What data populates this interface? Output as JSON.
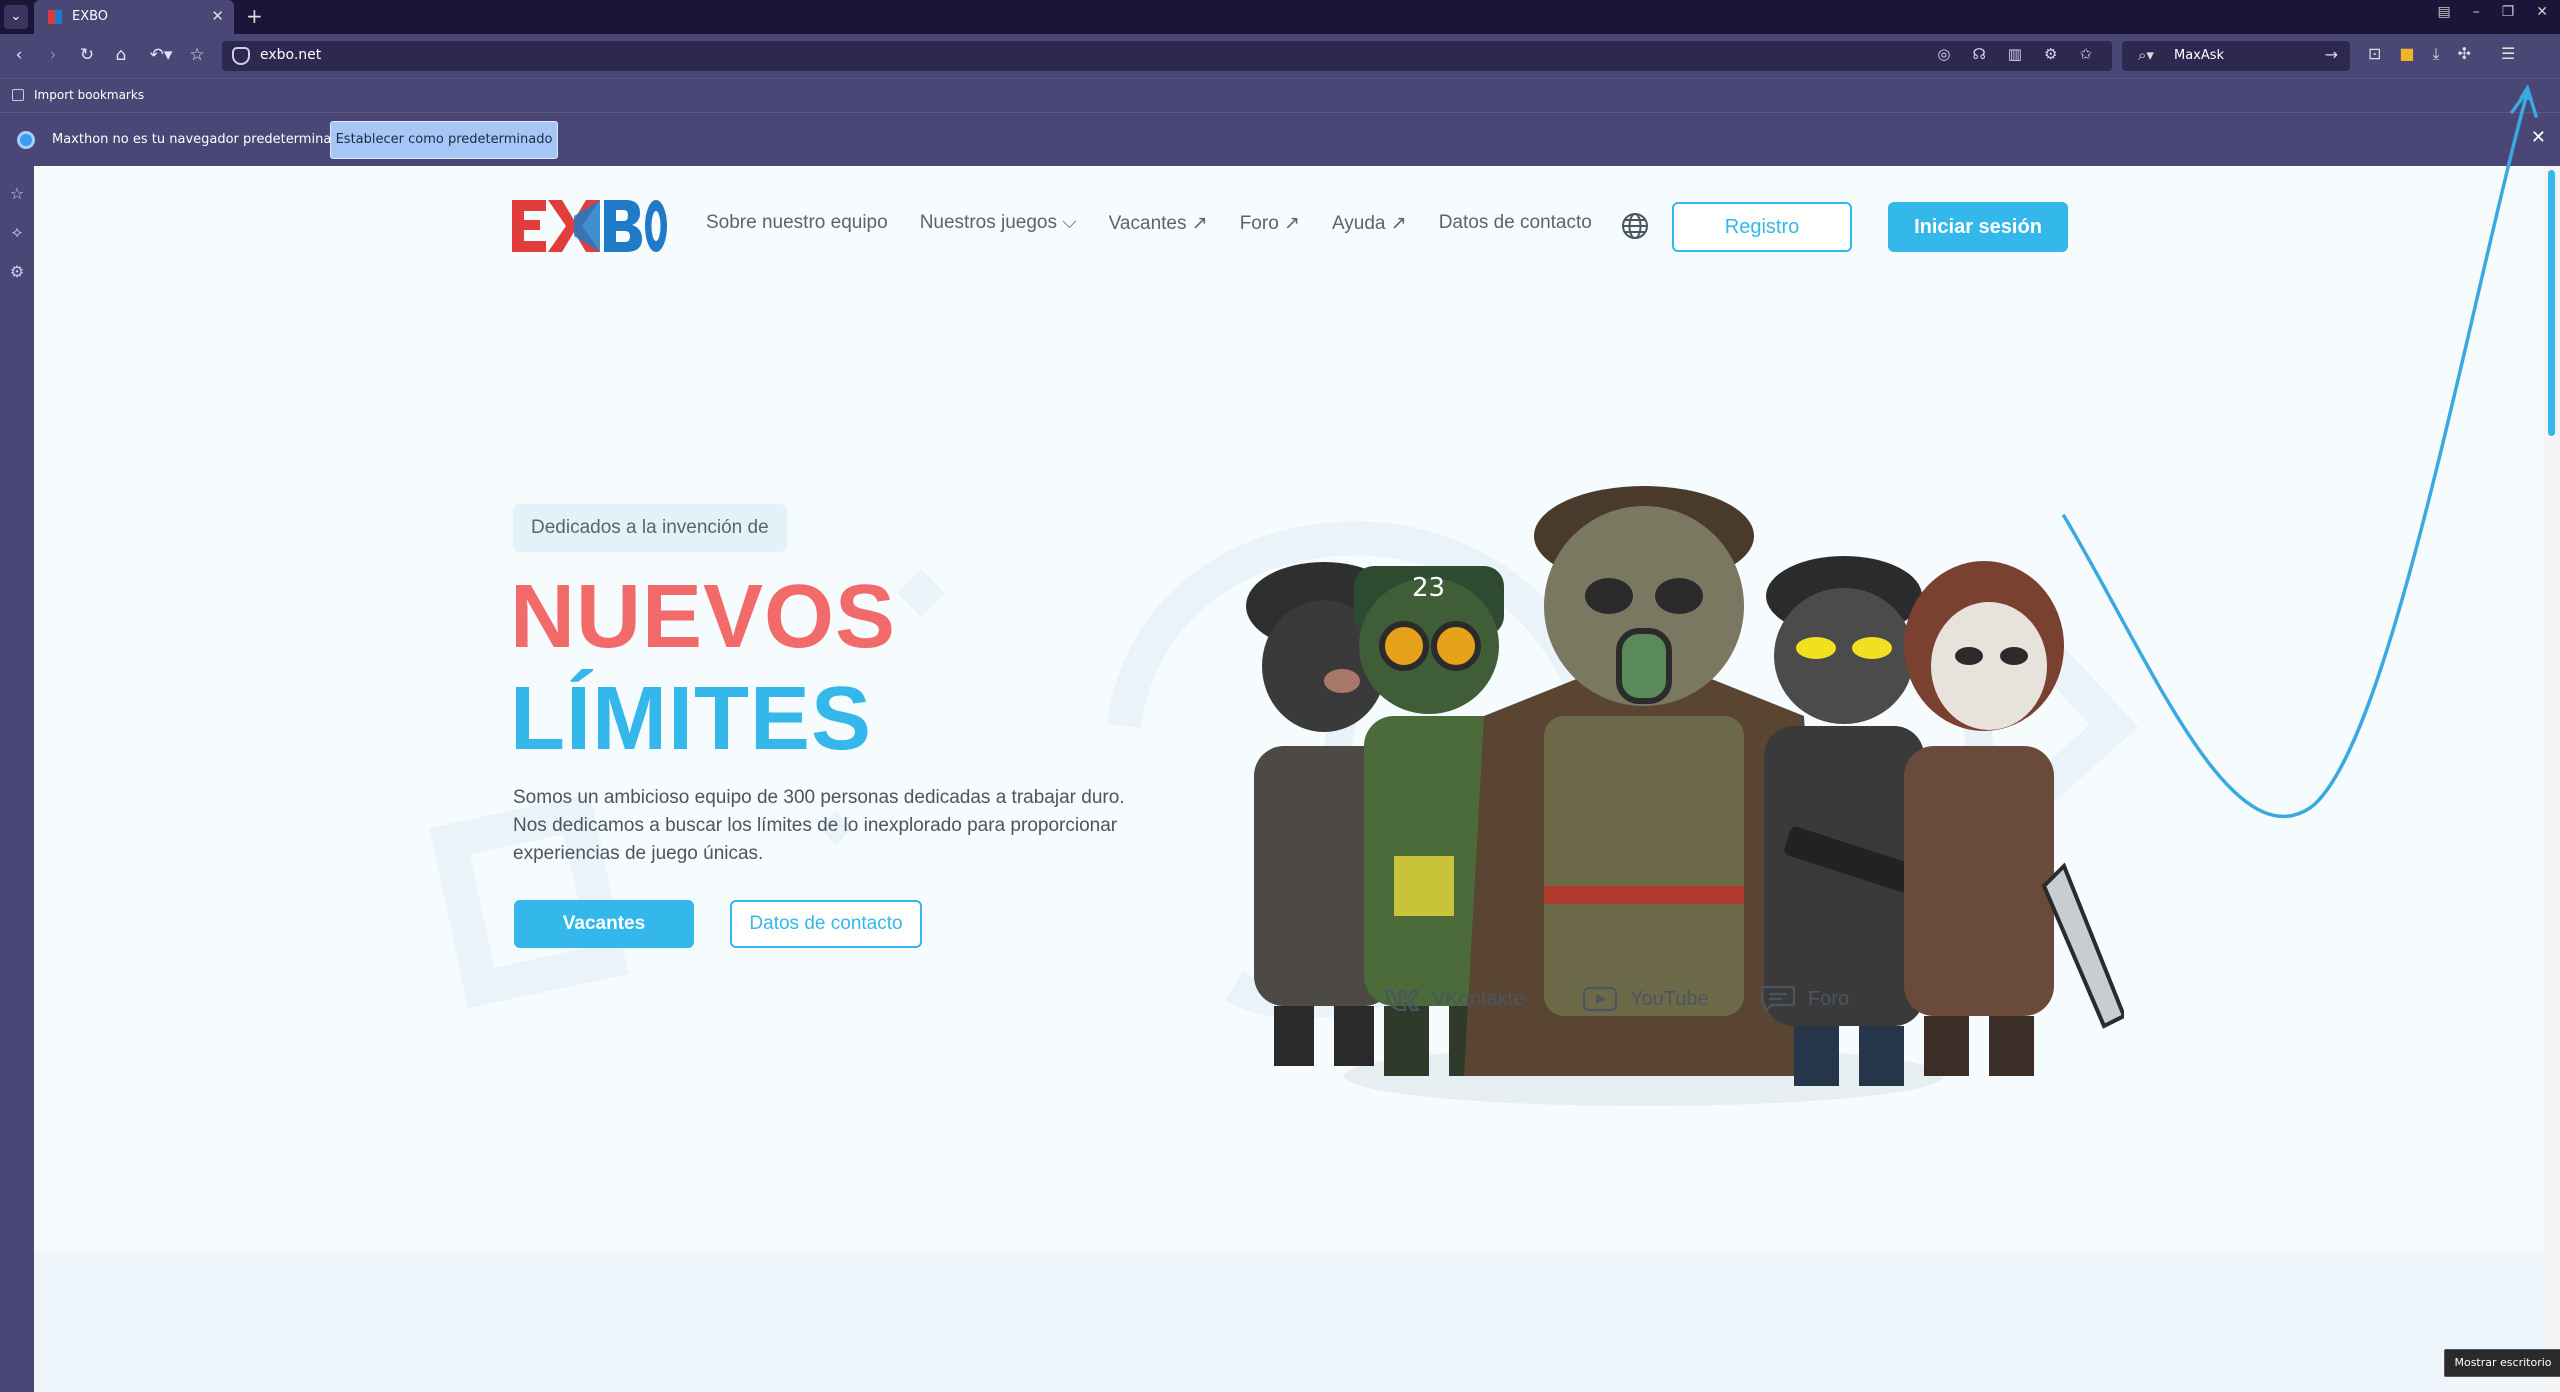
{
  "browser": {
    "tab_title": "EXBO",
    "url": "exbo.net",
    "search_text": "MaxAsk",
    "bookmark_label": "Import bookmarks",
    "infobar_text": "Maxthon no es tu navegador predeterminado",
    "infobar_button": "Establecer como predeterminado",
    "tooltip": "Mostrar escritorio"
  },
  "site": {
    "nav": [
      "Sobre nuestro equipo",
      "Nuestros juegos ⌵",
      "Vacantes ↗",
      "Foro ↗",
      "Ayuda ↗",
      "Datos de contacto"
    ],
    "register": "Registro",
    "login": "Iniciar sesión",
    "hero": {
      "tag": "Dedicados a la invención de",
      "line1": "NUEVOS",
      "line2": "LÍMITES",
      "desc": "Somos un ambicioso equipo de 300 personas dedicadas a trabajar duro. Nos dedicamos a buscar los límites de lo inexplorado para proporcionar experiencias de juego únicas.",
      "btn_primary": "Vacantes",
      "btn_secondary": "Datos de contacto"
    },
    "social": [
      "VKontakte",
      "YouTube",
      "Foro"
    ]
  },
  "colors": {
    "accent": "#34b7ea",
    "accent_red": "#f26a6a",
    "chrome": "#4a4776",
    "annotation_arrow": "#3aa9e0"
  }
}
